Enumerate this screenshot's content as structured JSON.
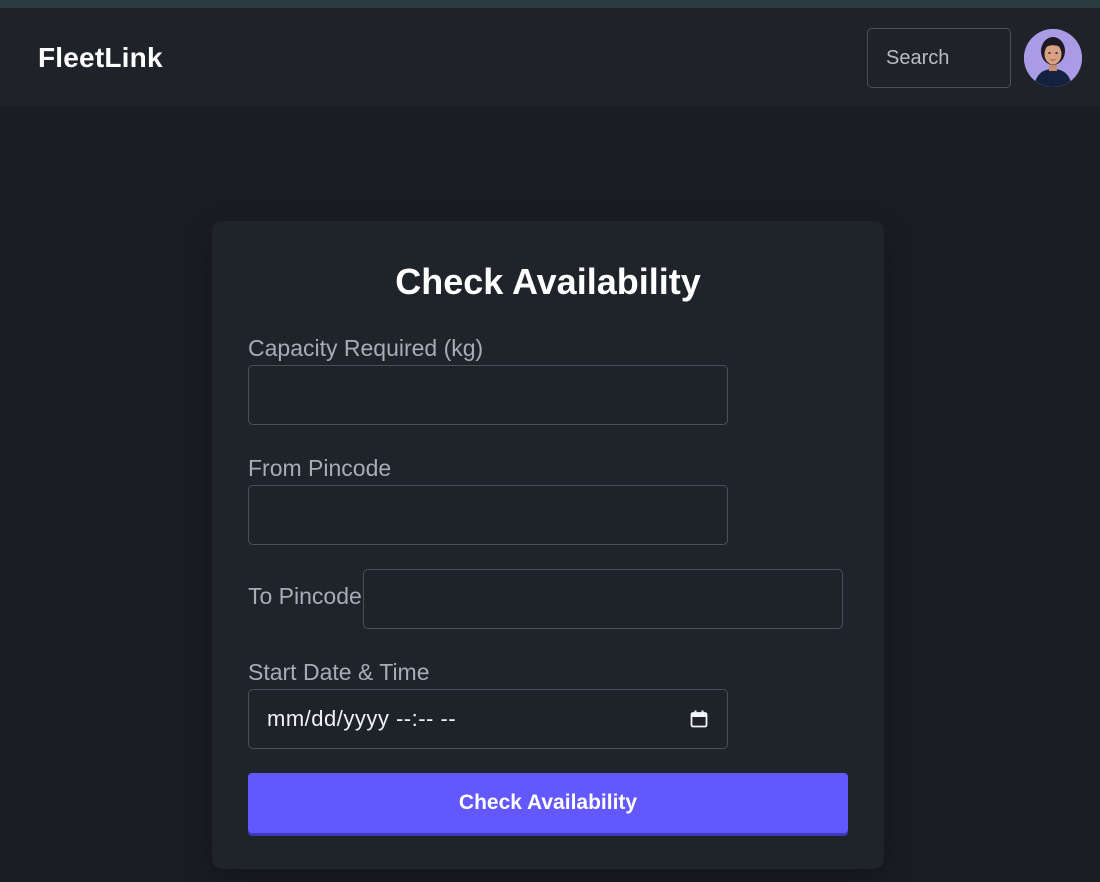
{
  "app": {
    "brand": "FleetLink"
  },
  "header": {
    "search_placeholder": "Search",
    "avatar_icon": "user-avatar-photo"
  },
  "form": {
    "title": "Check Availability",
    "capacity": {
      "label": "Capacity Required (kg)",
      "value": ""
    },
    "from_pincode": {
      "label": "From Pincode",
      "value": ""
    },
    "to_pincode": {
      "label": "To Pincode",
      "value": ""
    },
    "start_datetime": {
      "label": "Start Date & Time",
      "placeholder": "mm/dd/yyyy --:-- --",
      "icon": "calendar-icon"
    },
    "submit_label": "Check Availability"
  },
  "colors": {
    "background": "#1a1e24",
    "navbar": "#1f2329",
    "card": "#1f232a",
    "accent": "#6258fe",
    "label": "#a7adb5"
  }
}
